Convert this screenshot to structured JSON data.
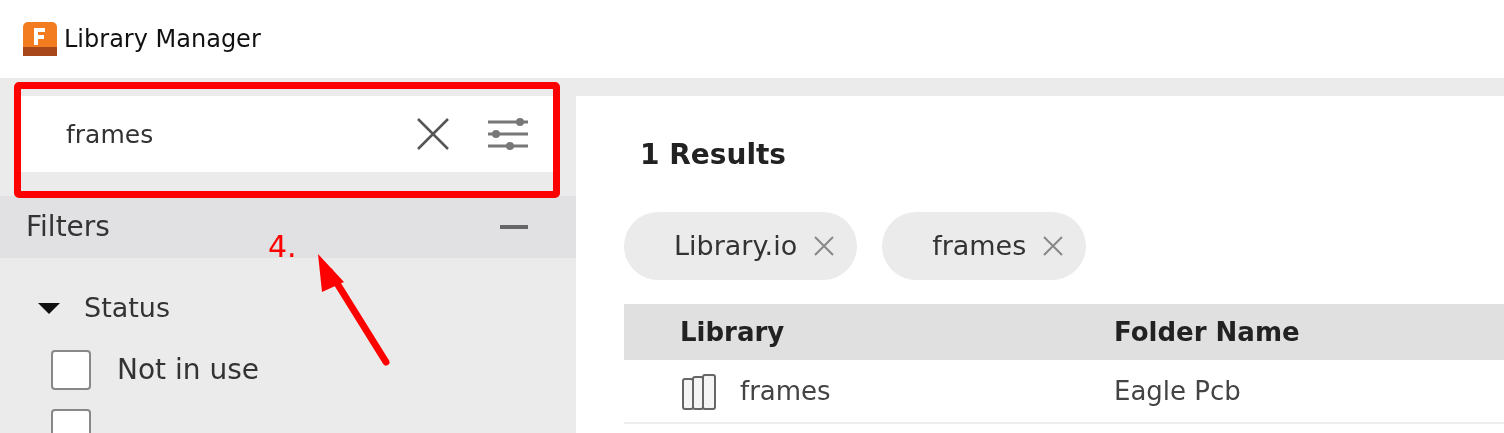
{
  "window": {
    "title": "Library Manager"
  },
  "search": {
    "value": "frames"
  },
  "filters": {
    "title": "Filters",
    "expanded": true,
    "groups": [
      {
        "label": "Status",
        "expanded": true,
        "options": [
          {
            "label": "Not in use",
            "checked": false
          },
          {
            "checked": false
          }
        ]
      }
    ]
  },
  "results": {
    "title": "1 Results",
    "chips": [
      {
        "label": "Library.io"
      },
      {
        "label": "frames"
      }
    ],
    "table": {
      "columns": [
        "Library",
        "Folder Name"
      ],
      "rows": [
        {
          "library": "frames",
          "folder": "Eagle Pcb"
        }
      ]
    }
  },
  "annotation": {
    "label": "4."
  }
}
